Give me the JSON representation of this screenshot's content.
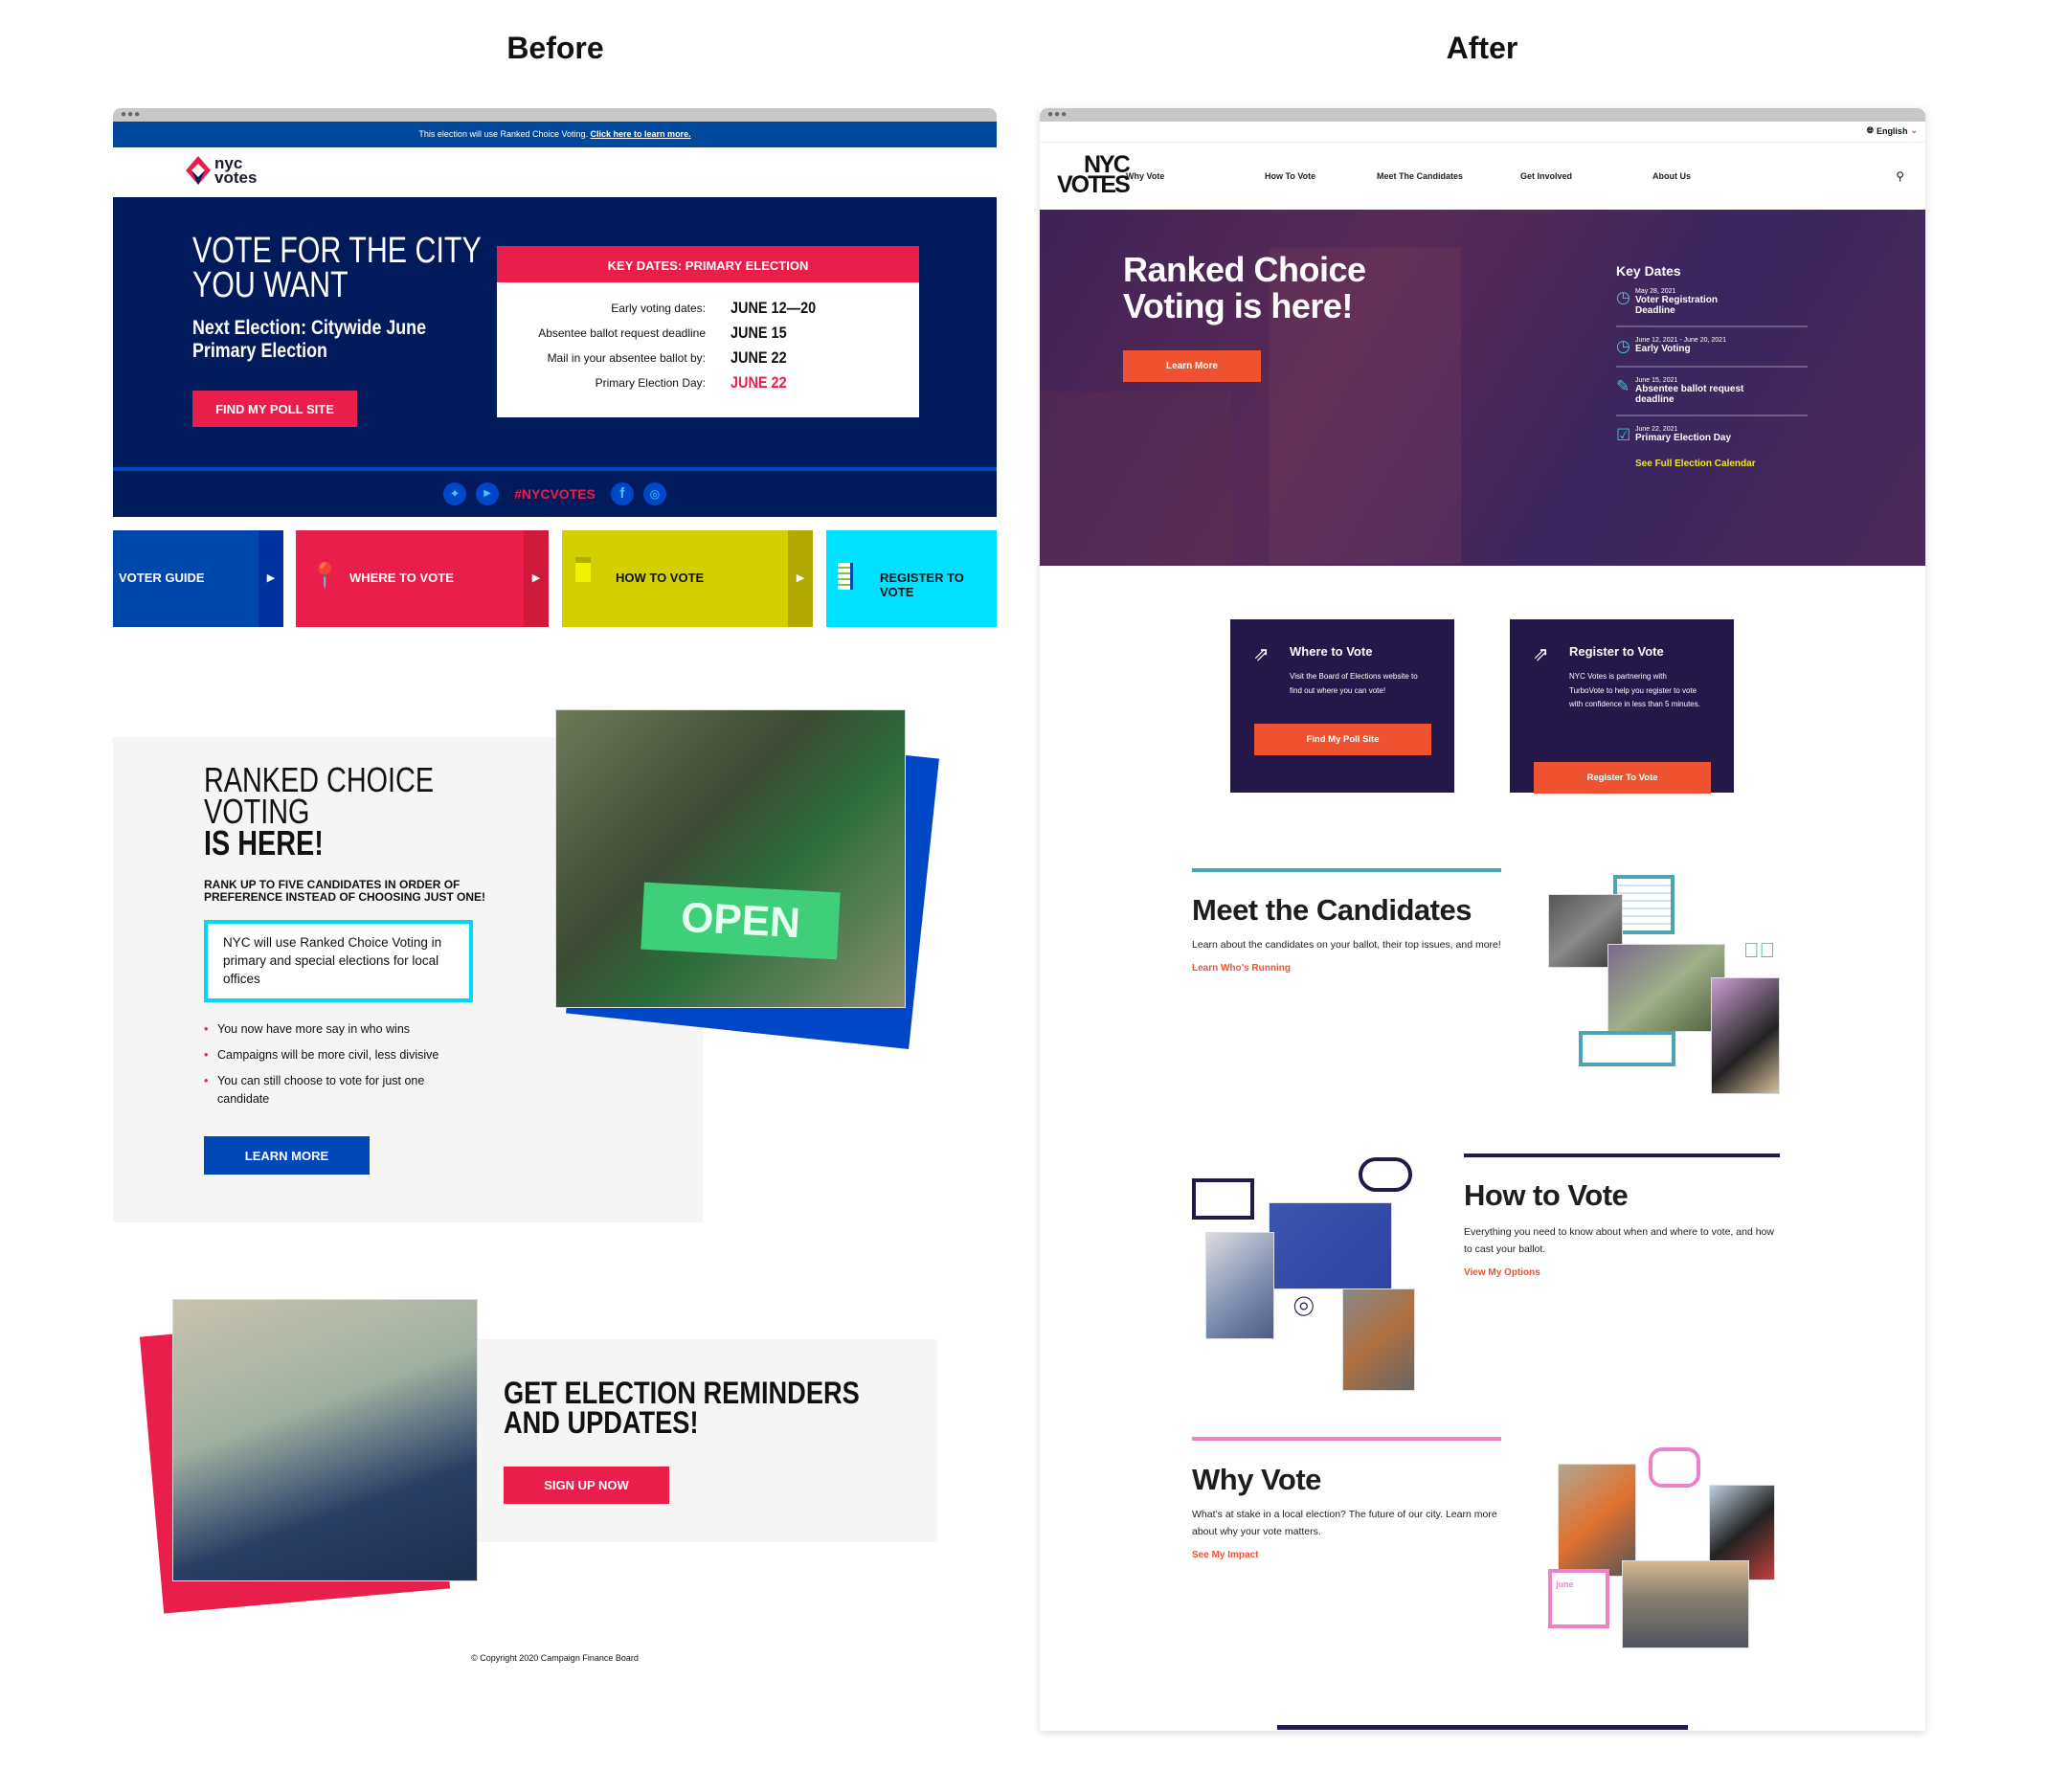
{
  "labels": {
    "before": "Before",
    "after": "After"
  },
  "before": {
    "banner": {
      "text": "This election will use Ranked Choice Voting. ",
      "link": "Click here to learn more."
    },
    "logo": {
      "line1": "nyc",
      "line2": "votes"
    },
    "hero": {
      "title_line1": "VOTE FOR THE CITY",
      "title_line2": "YOU WANT",
      "subtitle": "Next Election: Citywide June Primary Election",
      "button": "FIND MY POLL SITE"
    },
    "key_dates": {
      "header": "KEY DATES: PRIMARY ELECTION",
      "rows": [
        {
          "label": "Early voting dates:",
          "value": "JUNE 12—20"
        },
        {
          "label": "Absentee ballot request deadline",
          "value": "JUNE 15"
        },
        {
          "label": "Mail in your absentee ballot by:",
          "value": "JUNE 22"
        },
        {
          "label": "Primary Election Day:",
          "value": "JUNE 22"
        }
      ]
    },
    "social": {
      "hashtag": "#NYCVOTES",
      "icons": [
        "twitter-icon",
        "youtube-icon",
        "facebook-icon",
        "instagram-icon"
      ]
    },
    "tiles": [
      {
        "label": "VOTER GUIDE",
        "color": "#0047ab"
      },
      {
        "label": "WHERE TO VOTE",
        "color": "#e91e4a"
      },
      {
        "label": "HOW TO VOTE",
        "color": "#d4cf00"
      },
      {
        "label": "REGISTER TO VOTE",
        "color": "#00e0ff"
      }
    ],
    "rcv": {
      "title_line1": "RANKED CHOICE",
      "title_line2": "VOTING",
      "title_line3": "IS HERE!",
      "subtitle": "RANK UP TO FIVE CANDIDATES IN ORDER OF PREFERENCE INSTEAD OF CHOOSING JUST ONE!",
      "callout": "NYC will use Ranked Choice Voting in primary and special elections for local offices",
      "bullets": [
        "You now have more say in who wins",
        "Campaigns will be more civil, less divisive",
        "You can still choose to vote for just one candidate"
      ],
      "button": "LEARN MORE",
      "photo_sign": "OPEN"
    },
    "reminders": {
      "title": "GET ELECTION REMINDERS AND UPDATES!",
      "button": "SIGN UP NOW"
    },
    "footer": "© Copyright 2020 Campaign Finance Board"
  },
  "after": {
    "language": "English",
    "logo": {
      "line1": "NYC",
      "line2": "VOTES"
    },
    "nav": [
      "Why Vote",
      "How To Vote",
      "Meet The Candidates",
      "Get Involved",
      "About Us"
    ],
    "hero": {
      "title_line1": "Ranked Choice",
      "title_line2": "Voting is here!",
      "button": "Learn More"
    },
    "key_dates": {
      "title": "Key Dates",
      "items": [
        {
          "date": "May 28, 2021",
          "label": "Voter Registration Deadline",
          "icon": "clock-icon"
        },
        {
          "date": "June 12, 2021 - June 20, 2021",
          "label": "Early Voting",
          "icon": "clock-icon"
        },
        {
          "date": "June 15, 2021",
          "label": "Absentee ballot request deadline",
          "icon": "pen-icon"
        },
        {
          "date": "June 22, 2021",
          "label": "Primary Election Day",
          "icon": "calendar-check-icon"
        }
      ],
      "link": "See Full Election Calendar"
    },
    "cards": [
      {
        "title": "Where to Vote",
        "body": "Visit the Board of Elections website to find out where you can vote!",
        "button": "Find My Poll Site"
      },
      {
        "title": "Register to Vote",
        "body": "NYC Votes is partnering with TurboVote to help you register to vote with confidence in less than 5 minutes.",
        "button": "Register To Vote"
      }
    ],
    "sections": [
      {
        "title": "Meet the Candidates",
        "body": "Learn about the candidates on your ballot, their top issues, and more!",
        "link": "Learn Who’s Running",
        "accent": "#4ba3b5"
      },
      {
        "title": "How to Vote",
        "body": "Everything you need to know about when and where to vote, and how to cast your ballot.",
        "link": "View My Options",
        "accent": "#24174a"
      },
      {
        "title": "Why Vote",
        "body": "What’s at stake in a local election? The future of our city. Learn more about why your vote matters.",
        "link": "See My Impact",
        "accent": "#ee82c8",
        "calendar_month": "june"
      }
    ]
  },
  "colors": {
    "navy": "#001a5c",
    "red": "#e91e4a",
    "orange": "#ee5231",
    "purple": "#24174a",
    "teal": "#4ba3b5",
    "pink": "#ee82c8",
    "yellow": "#f2e52a"
  }
}
